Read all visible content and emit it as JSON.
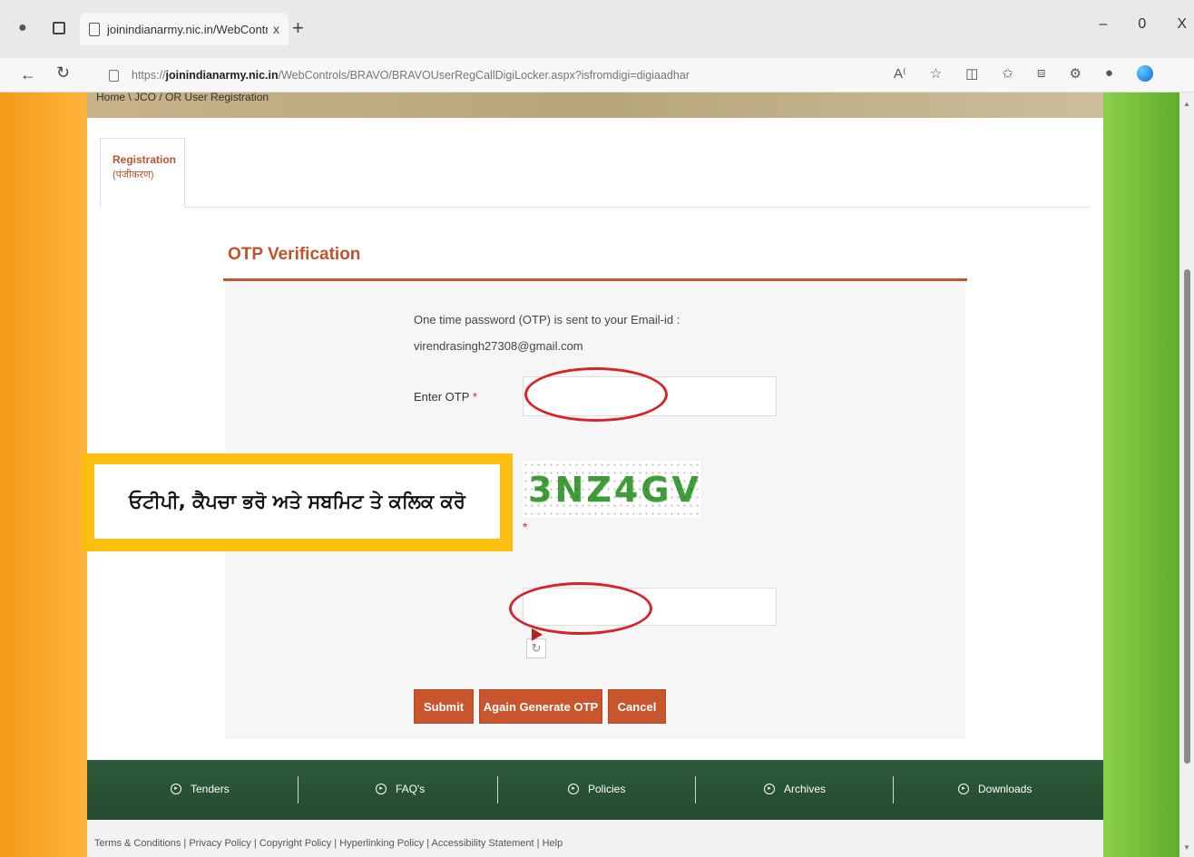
{
  "browser": {
    "tab_title": "joinindianarmy.nic.in/WebContr",
    "tab_close": "x",
    "new_tab": "+",
    "window_controls": [
      "–",
      "0",
      "X"
    ],
    "url_prefix": "https://",
    "url_domain": "joinindianarmy.nic.in",
    "url_path": "/WebControls/BRAVO/BRAVOUserRegCallDigiLocker.aspx?isfromdigi=digiaadhar"
  },
  "page": {
    "breadcrumb": "Home \\ JCO / OR User Registration",
    "tab_label": "Registration",
    "tab_sublabel": "(पंजीकरण)",
    "section_title": "OTP Verification",
    "info_line1": "One time password (OTP) is sent to your Email-id :",
    "info_line2": "virendrasingh27308@gmail.com",
    "otp_label": "Enter OTP",
    "required_mark": "*",
    "otp_value": "",
    "captcha_text": "3NZ4GV",
    "captcha_value": "",
    "buttons": {
      "submit": "Submit",
      "again": "Again Generate OTP",
      "cancel": "Cancel"
    }
  },
  "footer": {
    "nav": [
      "Tenders",
      "FAQ's",
      "Policies",
      "Archives",
      "Downloads"
    ],
    "links": "Terms & Conditions | Privacy Policy | Copyright Policy | Hyperlinking Policy | Accessibility Statement | Help"
  },
  "annotation": {
    "text": "ਓਟੀਪੀ, ਕੈਪਚਾ ਭਰੋ ਅਤੇ ਸਬਮਿਟ ਤੇ ਕਲਿਕ ਕਰੋ"
  },
  "colors": {
    "accent": "#c9552e",
    "highlight_ring": "#d6242a",
    "callout_border": "#fcbf10",
    "footer_green": "#2e5a3a"
  }
}
